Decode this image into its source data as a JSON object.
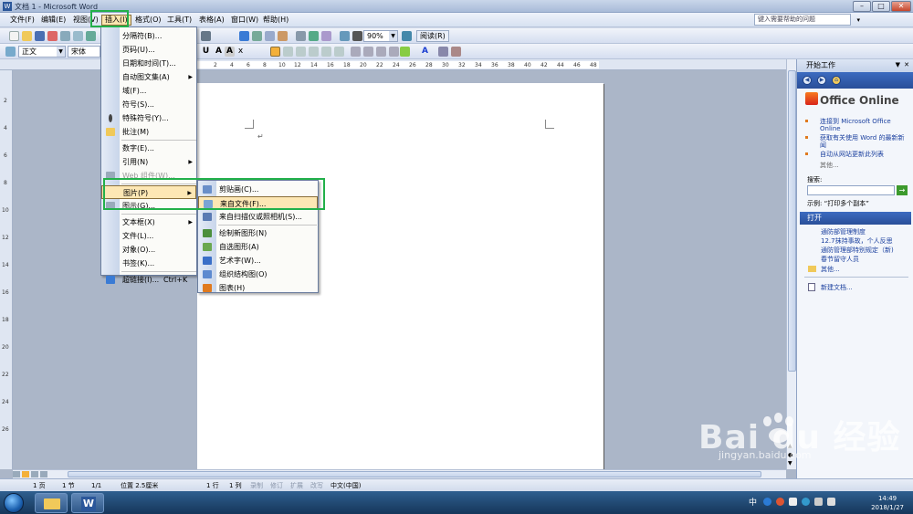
{
  "window": {
    "title": "文档 1 - Microsoft Word",
    "min_symbol": "–",
    "max_symbol": "□",
    "close_symbol": "✕"
  },
  "menubar": {
    "items": [
      {
        "label": "文件(F)"
      },
      {
        "label": "编辑(E)"
      },
      {
        "label": "视图(V)"
      },
      {
        "label": "插入(I)"
      },
      {
        "label": "格式(O)"
      },
      {
        "label": "工具(T)"
      },
      {
        "label": "表格(A)"
      },
      {
        "label": "窗口(W)"
      },
      {
        "label": "帮助(H)"
      }
    ],
    "help_placeholder": "键入需要帮助的问题"
  },
  "toolbar": {
    "zoom": "90%",
    "reading_label": "阅读(R)",
    "style": "正文",
    "font": "宋体"
  },
  "ruler": {
    "h_ticks": [
      "2",
      "4",
      "6",
      "8",
      "10",
      "12",
      "14",
      "16",
      "18",
      "20",
      "22",
      "24",
      "26",
      "28",
      "30",
      "32",
      "34",
      "36",
      "38",
      "40",
      "42",
      "44",
      "46",
      "48"
    ],
    "v_ticks": [
      "2",
      "4",
      "6",
      "8",
      "10",
      "12",
      "14",
      "16",
      "18",
      "20",
      "22",
      "24",
      "26"
    ]
  },
  "document": {
    "paragraph_mark": "↵"
  },
  "insert_menu": {
    "items": [
      {
        "label": "分隔符(B)...",
        "shortcut": "",
        "submenu": false,
        "disabled": false,
        "icon": ""
      },
      {
        "label": "页码(U)...",
        "shortcut": "",
        "submenu": false,
        "disabled": false,
        "icon": ""
      },
      {
        "label": "日期和时间(T)...",
        "shortcut": "",
        "submenu": false,
        "disabled": false,
        "icon": ""
      },
      {
        "label": "自动图文集(A)",
        "shortcut": "",
        "submenu": true,
        "disabled": false,
        "icon": ""
      },
      {
        "label": "域(F)...",
        "shortcut": "",
        "submenu": false,
        "disabled": false,
        "icon": ""
      },
      {
        "label": "符号(S)...",
        "shortcut": "",
        "submenu": false,
        "disabled": false,
        "icon": ""
      },
      {
        "label": "特殊符号(Y)...",
        "shortcut": "",
        "submenu": false,
        "disabled": false,
        "icon": "special-symbol-icon"
      },
      {
        "label": "批注(M)",
        "shortcut": "",
        "submenu": false,
        "disabled": false,
        "icon": "comment-icon"
      },
      {
        "label": "数字(E)...",
        "shortcut": "",
        "submenu": false,
        "disabled": false,
        "icon": ""
      },
      {
        "label": "引用(N)",
        "shortcut": "",
        "submenu": true,
        "disabled": false,
        "icon": ""
      },
      {
        "label": "Web 组件(W)...",
        "shortcut": "",
        "submenu": false,
        "disabled": true,
        "icon": "web-component-icon"
      },
      {
        "label": "图片(P)",
        "shortcut": "",
        "submenu": true,
        "disabled": false,
        "icon": "",
        "highlight": true
      },
      {
        "label": "图示(G)...",
        "shortcut": "",
        "submenu": false,
        "disabled": false,
        "icon": "diagram-icon"
      },
      {
        "label": "文本框(X)",
        "shortcut": "",
        "submenu": true,
        "disabled": false,
        "icon": ""
      },
      {
        "label": "文件(L)...",
        "shortcut": "",
        "submenu": false,
        "disabled": false,
        "icon": ""
      },
      {
        "label": "对象(O)...",
        "shortcut": "",
        "submenu": false,
        "disabled": false,
        "icon": ""
      },
      {
        "label": "书签(K)...",
        "shortcut": "",
        "submenu": false,
        "disabled": false,
        "icon": ""
      },
      {
        "label": "超链接(I)...",
        "shortcut": "Ctrl+K",
        "submenu": false,
        "disabled": false,
        "icon": "hyperlink-icon"
      }
    ]
  },
  "picture_submenu": {
    "items": [
      {
        "label": "剪贴画(C)...",
        "icon": "clipart-icon"
      },
      {
        "label": "来自文件(F)...",
        "icon": "picture-from-file-icon",
        "highlight": true
      },
      {
        "label": "来自扫描仪或照相机(S)...",
        "icon": "scanner-icon"
      },
      {
        "label": "绘制新图形(N)",
        "icon": "new-drawing-icon"
      },
      {
        "label": "自选图形(A)",
        "icon": "autoshape-icon"
      },
      {
        "label": "艺术字(W)...",
        "icon": "wordart-icon"
      },
      {
        "label": "组织结构图(O)",
        "icon": "org-chart-icon"
      },
      {
        "label": "图表(H)",
        "icon": "chart-icon"
      }
    ]
  },
  "taskpane": {
    "title": "开始工作",
    "logo": "Office Online",
    "links": [
      "连接到 Microsoft Office Online",
      "获取有关使用 Word 的最新新闻",
      "自动从网站更新此列表"
    ],
    "more": "其他...",
    "search_label": "搜索:",
    "example": "示例: “打印多个副本”",
    "open_title": "打开",
    "recent_files": [
      "通防部管理制度",
      "12.7抹持事故，个人反思",
      "通防管理部特别规定（新)",
      "春节留守人员"
    ],
    "open_more": "其他...",
    "new_doc": "新建文档..."
  },
  "status": {
    "page": "1 页",
    "section": "1 节",
    "pages": "1/1",
    "position": "位置 2.5厘米",
    "line": "1 行",
    "column": "1 列",
    "rec": "录制",
    "trk": "修订",
    "ext": "扩展",
    "ovr": "改写",
    "lang": "中文(中国)"
  },
  "taskbar": {
    "time": "14:49",
    "date": "2018/1/27",
    "ime": "中"
  },
  "watermark": {
    "logo": "Bai du 经验",
    "url": "jingyan.baidu.com"
  },
  "colors": {
    "highlight": "#fde7b4",
    "annotation_box": "#22b04a",
    "taskpane_blue": "#2a4f99"
  }
}
